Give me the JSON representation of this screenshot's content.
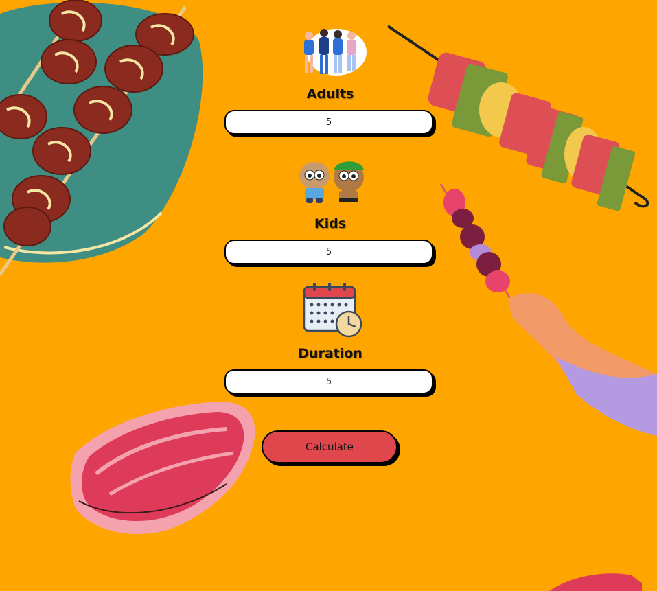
{
  "form": {
    "adults": {
      "label": "Adults",
      "value": "5",
      "icon": "group-of-adults-icon"
    },
    "kids": {
      "label": "Kids",
      "value": "5",
      "icon": "two-kids-icon"
    },
    "duration": {
      "label": "Duration",
      "value": "5",
      "icon": "calendar-clock-icon"
    },
    "calculate_label": "Calculate"
  },
  "colors": {
    "background": "#FFA500",
    "button": "#E0474C",
    "field": "#FFFFFF",
    "plate": "#3E8E84",
    "meat_dark": "#8B2A1F",
    "steak": "#E0476A"
  }
}
